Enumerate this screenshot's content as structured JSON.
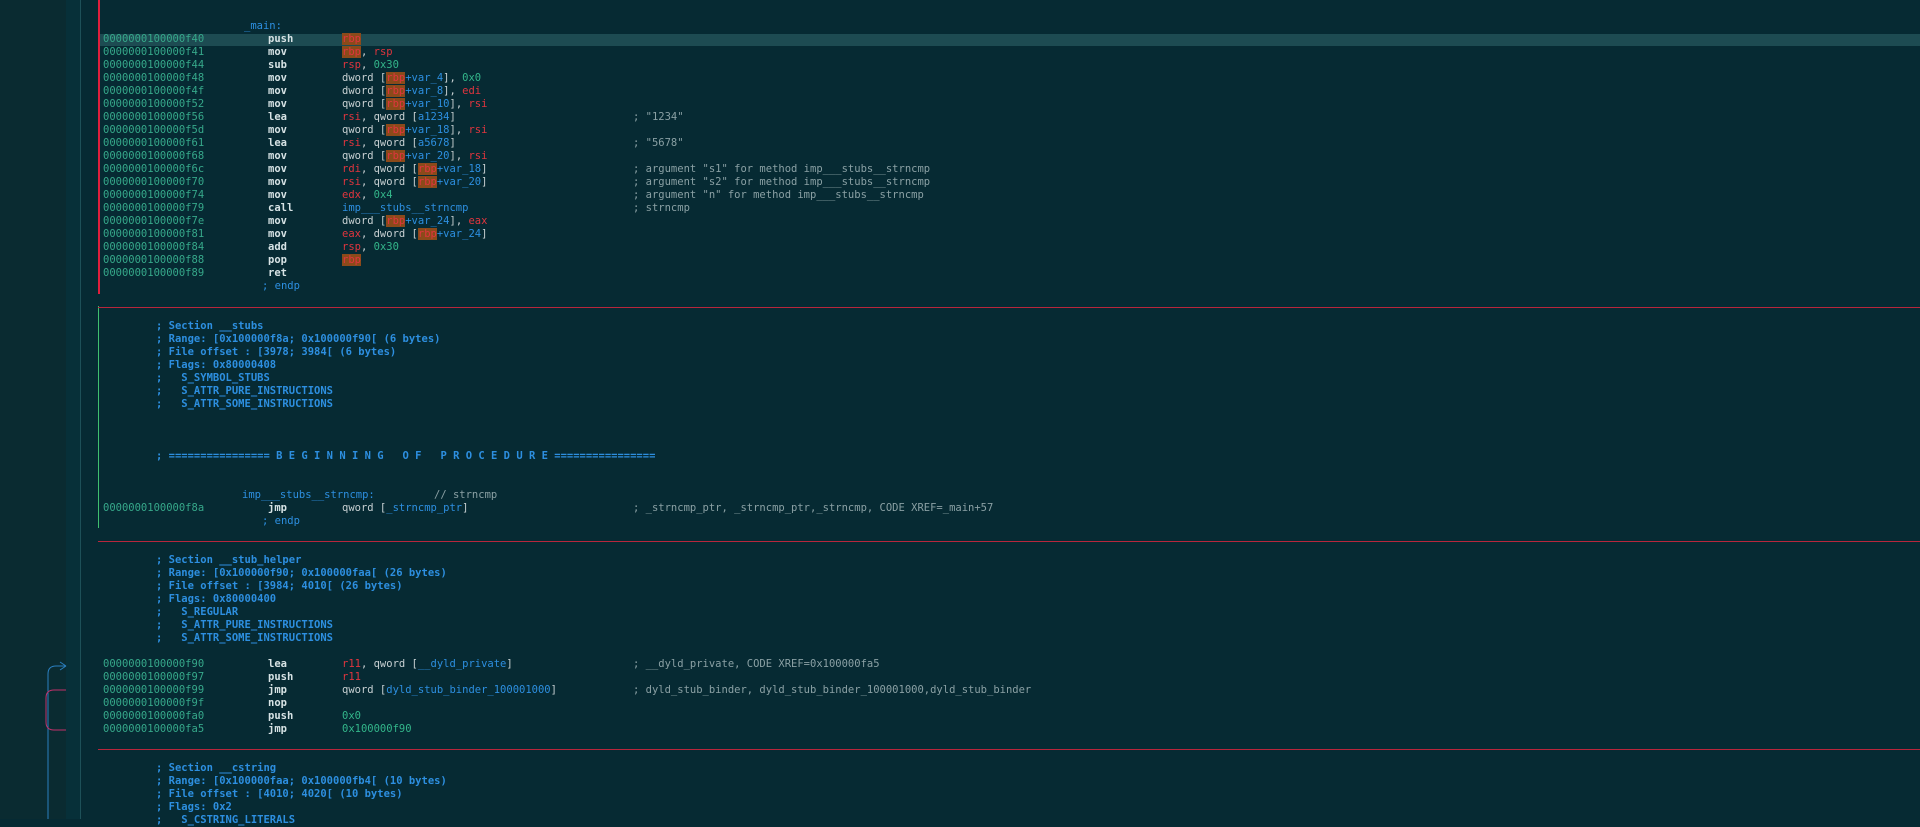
{
  "colors": {
    "background": "#062a33",
    "address": "#36a88a",
    "register": "#e0353e",
    "symbol": "#2d8fe0",
    "comment": "#8aa0a4",
    "separator": "#b8263c"
  },
  "main_label": "_main:",
  "main": [
    {
      "addr": "0000000100000f40",
      "mn": "push",
      "ops": [
        {
          "t": "rbp",
          "c": "rbp"
        }
      ]
    },
    {
      "addr": "0000000100000f41",
      "mn": "mov",
      "ops": [
        {
          "t": "rbp",
          "c": "rbp"
        },
        {
          "t": ", ",
          "c": "plain"
        },
        {
          "t": "rsp",
          "c": "reg"
        }
      ]
    },
    {
      "addr": "0000000100000f44",
      "mn": "sub",
      "ops": [
        {
          "t": "rsp",
          "c": "reg"
        },
        {
          "t": ", ",
          "c": "plain"
        },
        {
          "t": "0x30",
          "c": "num"
        }
      ]
    },
    {
      "addr": "0000000100000f48",
      "mn": "mov",
      "ops": [
        {
          "t": "dword [",
          "c": "plain"
        },
        {
          "t": "rbp",
          "c": "rbp"
        },
        {
          "t": "+var_4",
          "c": "sym"
        },
        {
          "t": "], ",
          "c": "plain"
        },
        {
          "t": "0x0",
          "c": "num"
        }
      ]
    },
    {
      "addr": "0000000100000f4f",
      "mn": "mov",
      "ops": [
        {
          "t": "dword [",
          "c": "plain"
        },
        {
          "t": "rbp",
          "c": "rbp"
        },
        {
          "t": "+var_8",
          "c": "sym"
        },
        {
          "t": "], ",
          "c": "plain"
        },
        {
          "t": "edi",
          "c": "reg"
        }
      ]
    },
    {
      "addr": "0000000100000f52",
      "mn": "mov",
      "ops": [
        {
          "t": "qword [",
          "c": "plain"
        },
        {
          "t": "rbp",
          "c": "rbp"
        },
        {
          "t": "+var_10",
          "c": "sym"
        },
        {
          "t": "], ",
          "c": "plain"
        },
        {
          "t": "rsi",
          "c": "reg"
        }
      ]
    },
    {
      "addr": "0000000100000f56",
      "mn": "lea",
      "ops": [
        {
          "t": "rsi",
          "c": "reg"
        },
        {
          "t": ", qword [",
          "c": "plain"
        },
        {
          "t": "a1234",
          "c": "sym"
        },
        {
          "t": "]",
          "c": "plain"
        }
      ],
      "cmt": "; \"1234\""
    },
    {
      "addr": "0000000100000f5d",
      "mn": "mov",
      "ops": [
        {
          "t": "qword [",
          "c": "plain"
        },
        {
          "t": "rbp",
          "c": "rbp"
        },
        {
          "t": "+var_18",
          "c": "sym"
        },
        {
          "t": "], ",
          "c": "plain"
        },
        {
          "t": "rsi",
          "c": "reg"
        }
      ]
    },
    {
      "addr": "0000000100000f61",
      "mn": "lea",
      "ops": [
        {
          "t": "rsi",
          "c": "reg"
        },
        {
          "t": ", qword [",
          "c": "plain"
        },
        {
          "t": "a5678",
          "c": "sym"
        },
        {
          "t": "]",
          "c": "plain"
        }
      ],
      "cmt": "; \"5678\""
    },
    {
      "addr": "0000000100000f68",
      "mn": "mov",
      "ops": [
        {
          "t": "qword [",
          "c": "plain"
        },
        {
          "t": "rbp",
          "c": "rbp"
        },
        {
          "t": "+var_20",
          "c": "sym"
        },
        {
          "t": "], ",
          "c": "plain"
        },
        {
          "t": "rsi",
          "c": "reg"
        }
      ]
    },
    {
      "addr": "0000000100000f6c",
      "mn": "mov",
      "ops": [
        {
          "t": "rdi",
          "c": "reg"
        },
        {
          "t": ", qword [",
          "c": "plain"
        },
        {
          "t": "rbp",
          "c": "rbp"
        },
        {
          "t": "+var_18",
          "c": "sym"
        },
        {
          "t": "]",
          "c": "plain"
        }
      ],
      "cmt": "; argument \"s1\" for method imp___stubs__strncmp"
    },
    {
      "addr": "0000000100000f70",
      "mn": "mov",
      "ops": [
        {
          "t": "rsi",
          "c": "reg"
        },
        {
          "t": ", qword [",
          "c": "plain"
        },
        {
          "t": "rbp",
          "c": "rbp"
        },
        {
          "t": "+var_20",
          "c": "sym"
        },
        {
          "t": "]",
          "c": "plain"
        }
      ],
      "cmt": "; argument \"s2\" for method imp___stubs__strncmp"
    },
    {
      "addr": "0000000100000f74",
      "mn": "mov",
      "ops": [
        {
          "t": "edx",
          "c": "reg"
        },
        {
          "t": ", ",
          "c": "plain"
        },
        {
          "t": "0x4",
          "c": "num"
        }
      ],
      "cmt": "; argument \"n\" for method imp___stubs__strncmp"
    },
    {
      "addr": "0000000100000f79",
      "mn": "call",
      "ops": [
        {
          "t": "imp___stubs__strncmp",
          "c": "sym"
        }
      ],
      "cmt": "; strncmp"
    },
    {
      "addr": "0000000100000f7e",
      "mn": "mov",
      "ops": [
        {
          "t": "dword [",
          "c": "plain"
        },
        {
          "t": "rbp",
          "c": "rbp"
        },
        {
          "t": "+var_24",
          "c": "sym"
        },
        {
          "t": "], ",
          "c": "plain"
        },
        {
          "t": "eax",
          "c": "reg"
        }
      ]
    },
    {
      "addr": "0000000100000f81",
      "mn": "mov",
      "ops": [
        {
          "t": "eax",
          "c": "reg"
        },
        {
          "t": ", dword [",
          "c": "plain"
        },
        {
          "t": "rbp",
          "c": "rbp"
        },
        {
          "t": "+var_24",
          "c": "sym"
        },
        {
          "t": "]",
          "c": "plain"
        }
      ]
    },
    {
      "addr": "0000000100000f84",
      "mn": "add",
      "ops": [
        {
          "t": "rsp",
          "c": "reg"
        },
        {
          "t": ", ",
          "c": "plain"
        },
        {
          "t": "0x30",
          "c": "num"
        }
      ]
    },
    {
      "addr": "0000000100000f88",
      "mn": "pop",
      "ops": [
        {
          "t": "rbp",
          "c": "rbp"
        }
      ]
    },
    {
      "addr": "0000000100000f89",
      "mn": "ret",
      "ops": []
    }
  ],
  "endp": "; endp",
  "stubs_section": [
    "; Section __stubs",
    "; Range: [0x100000f8a; 0x100000f90[ (6 bytes)",
    "; File offset : [3978; 3984[ (6 bytes)",
    "; Flags: 0x80000408",
    ";   S_SYMBOL_STUBS",
    ";   S_ATTR_PURE_INSTRUCTIONS",
    ";   S_ATTR_SOME_INSTRUCTIONS"
  ],
  "proc_banner": "; ================ B E G I N N I N G   O F   P R O C E D U R E ================",
  "stub_label": "imp___stubs__strncmp:",
  "stub_label_comment": "// strncmp",
  "stub": [
    {
      "addr": "0000000100000f8a",
      "mn": "jmp",
      "ops": [
        {
          "t": "qword [",
          "c": "plain"
        },
        {
          "t": "_strncmp_ptr",
          "c": "sym"
        },
        {
          "t": "]",
          "c": "plain"
        }
      ],
      "cmt": "; _strncmp_ptr, _strncmp_ptr,_strncmp, CODE XREF=_main+57"
    }
  ],
  "stub_helper_section": [
    "; Section __stub_helper",
    "; Range: [0x100000f90; 0x100000faa[ (26 bytes)",
    "; File offset : [3984; 4010[ (26 bytes)",
    "; Flags: 0x80000400",
    ";   S_REGULAR",
    ";   S_ATTR_PURE_INSTRUCTIONS",
    ";   S_ATTR_SOME_INSTRUCTIONS"
  ],
  "stub_helper": [
    {
      "addr": "0000000100000f90",
      "mn": "lea",
      "ops": [
        {
          "t": "r11",
          "c": "reg"
        },
        {
          "t": ", qword [",
          "c": "plain"
        },
        {
          "t": "__dyld_private",
          "c": "sym"
        },
        {
          "t": "]",
          "c": "plain"
        }
      ],
      "cmt": "; __dyld_private, CODE XREF=0x100000fa5"
    },
    {
      "addr": "0000000100000f97",
      "mn": "push",
      "ops": [
        {
          "t": "r11",
          "c": "reg"
        }
      ]
    },
    {
      "addr": "0000000100000f99",
      "mn": "jmp",
      "ops": [
        {
          "t": "qword [",
          "c": "plain"
        },
        {
          "t": "dyld_stub_binder_100001000",
          "c": "sym"
        },
        {
          "t": "]",
          "c": "plain"
        }
      ],
      "cmt": "; dyld_stub_binder, dyld_stub_binder_100001000,dyld_stub_binder"
    },
    {
      "addr": "0000000100000f9f",
      "mn": "nop",
      "ops": []
    },
    {
      "addr": "0000000100000fa0",
      "mn": "push",
      "ops": [
        {
          "t": "0x0",
          "c": "num"
        }
      ]
    },
    {
      "addr": "0000000100000fa5",
      "mn": "jmp",
      "ops": [
        {
          "t": "0x100000f90",
          "c": "num"
        }
      ]
    }
  ],
  "cstring_section": [
    "; Section __cstring",
    "; Range: [0x100000faa; 0x100000fb4[ (10 bytes)",
    "; File offset : [4010; 4020[ (10 bytes)",
    "; Flags: 0x2",
    ";   S_CSTRING_LITERALS"
  ]
}
